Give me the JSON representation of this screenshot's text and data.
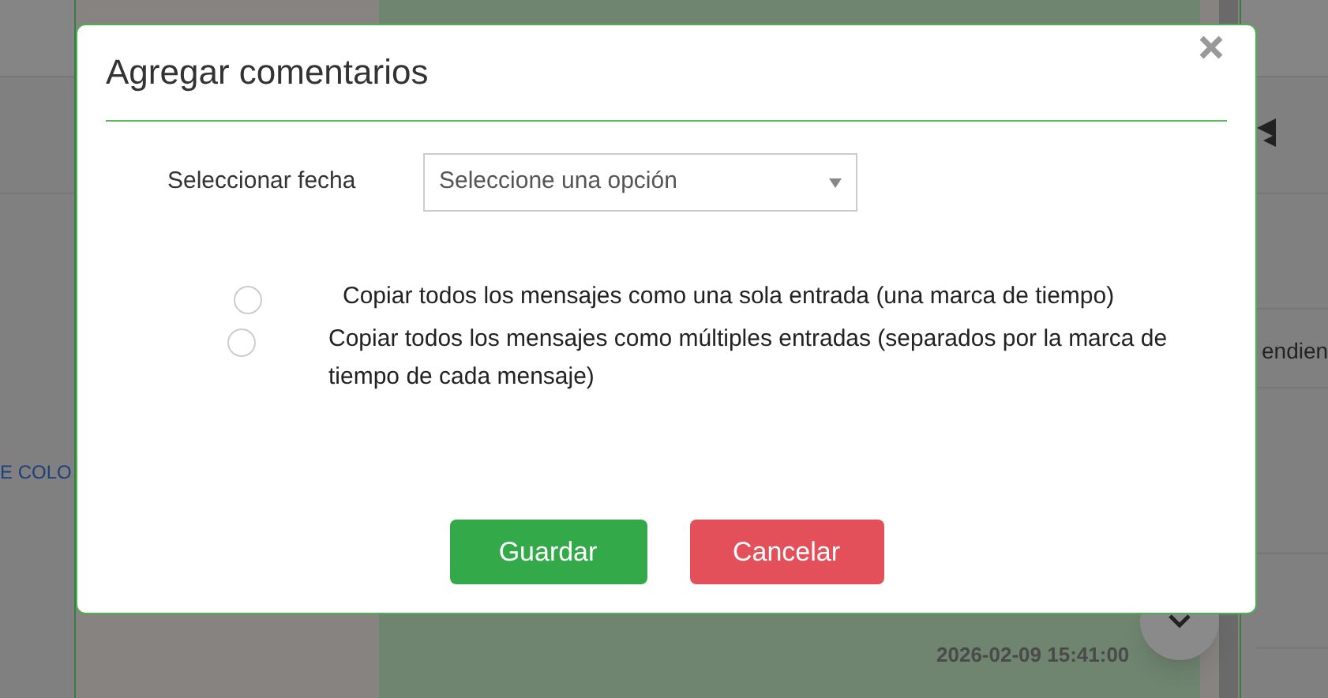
{
  "background": {
    "left_link": "E COLO",
    "right_text": "endien",
    "timestamp": "2026-02-09 15:41:00"
  },
  "dialog": {
    "title": "Agregar comentarios",
    "field": {
      "label": "Seleccionar fecha",
      "placeholder": "Seleccione una opción"
    },
    "options": [
      {
        "label": "Copiar todos los mensajes como una sola entrada (una marca de tiempo)",
        "selected": false
      },
      {
        "label": "Copiar todos los mensajes como múltiples entradas (separados por la marca de tiempo de cada mensaje)",
        "selected": false
      }
    ],
    "buttons": [
      {
        "label": "Guardar",
        "kind": "primary"
      },
      {
        "label": "Cancelar",
        "kind": "danger"
      }
    ]
  }
}
